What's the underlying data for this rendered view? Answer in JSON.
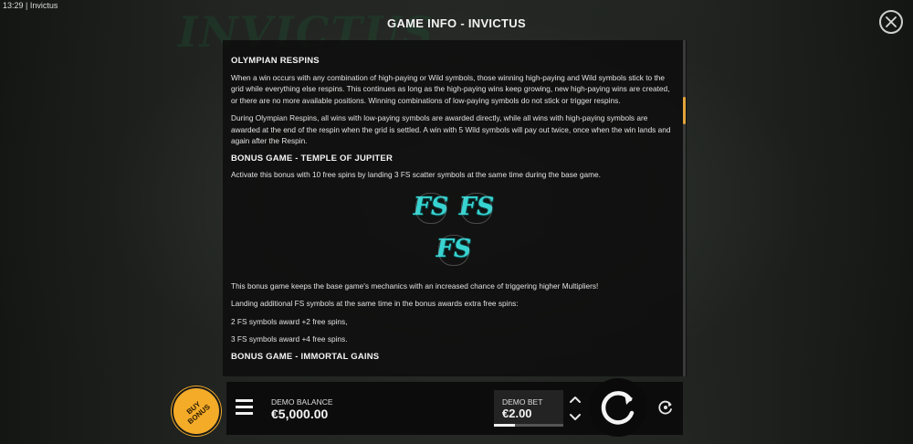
{
  "status_bar": {
    "time": "13:29",
    "app_name": "Invictus"
  },
  "background_logo": "INVICTUS",
  "header": {
    "title": "GAME INFO - INVICTUS"
  },
  "info": {
    "olympian_respins": {
      "heading": "OLYMPIAN RESPINS",
      "p1": "When a win occurs with any combination of high-paying or Wild symbols, those winning high-paying and Wild symbols stick to the grid while everything else respins. This continues as long as the high-paying wins keep growing, new high-paying wins are created, or there are no more available positions. Winning combinations of low-paying symbols do not stick or trigger respins.",
      "p2": "During Olympian Respins, all wins with low-paying symbols are awarded directly, while all wins with high-paying symbols are awarded at the end of the respin when the grid is settled. A win with 5 Wild symbols will pay out twice, once when the win lands and again after the Respin."
    },
    "temple_of_jupiter": {
      "heading": "BONUS GAME - TEMPLE OF JUPITER",
      "p1": "Activate this bonus with 10 free spins by landing 3 FS scatter symbols at the same time during the base game.",
      "symbol_text": "FS",
      "p2": "This bonus game keeps the base game's mechanics with an increased chance of triggering higher Multipliers!",
      "p3": "Landing additional FS symbols at the same time in the bonus awards extra free spins:",
      "p4": "2 FS symbols award +2 free spins,",
      "p5": "3 FS symbols award +4 free spins."
    },
    "immortal_gains": {
      "heading": "BONUS GAME - IMMORTAL GAINS"
    }
  },
  "scrollbar": {
    "accent_color": "#e4a43a"
  },
  "controls": {
    "buy_bonus_label": "BUY BONUS",
    "balance_label": "DEMO BALANCE",
    "balance_value": "€5,000.00",
    "bet_label": "DEMO BET",
    "bet_value": "€2.00",
    "bet_level_fraction": 0.3,
    "icons": [
      "menu-icon",
      "chevron-up-icon",
      "chevron-down-icon",
      "spin-icon",
      "autoplay-icon",
      "close-icon"
    ]
  }
}
